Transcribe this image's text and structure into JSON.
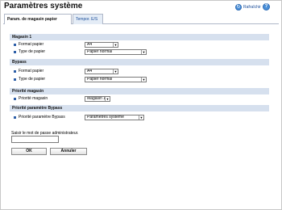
{
  "page": {
    "title": "Paramètres système",
    "refresh_label": "Rafraîchir",
    "help_symbol": "?",
    "refresh_symbol": "↻"
  },
  "tabs": [
    {
      "label": "Param. de magasin papier",
      "active": true
    },
    {
      "label": "Tempor. E/S",
      "active": false
    }
  ],
  "sections": {
    "magasin1": {
      "title": "Magasin 1",
      "paper_size_label": "Format papier",
      "paper_size_value": "A4",
      "paper_type_label": "Type de papier",
      "paper_type_value": "Papier normal"
    },
    "bypass": {
      "title": "Bypass",
      "paper_size_label": "Format papier",
      "paper_size_value": "A4",
      "paper_type_label": "Type de papier",
      "paper_type_value": "Papier normal"
    },
    "tray_priority": {
      "title": "Priorité magasin",
      "label": "Priorité magasin",
      "value": "Magasin 1"
    },
    "bypass_priority": {
      "title": "Priorité paramètre Bypass",
      "label": "Priorité paramètre Bypass",
      "value": "Paramètres système"
    }
  },
  "password": {
    "label": "Saisir le mot de passe administrateur.",
    "value": ""
  },
  "buttons": {
    "ok": "OK",
    "cancel": "Annuler"
  },
  "icons": {
    "refresh": "refresh-icon",
    "help": "help-icon",
    "dropdown": "chevron-down-icon"
  },
  "colors": {
    "section_bg": "#d6e0ee",
    "accent": "#2d5fa8",
    "link": "#1a4d99"
  }
}
